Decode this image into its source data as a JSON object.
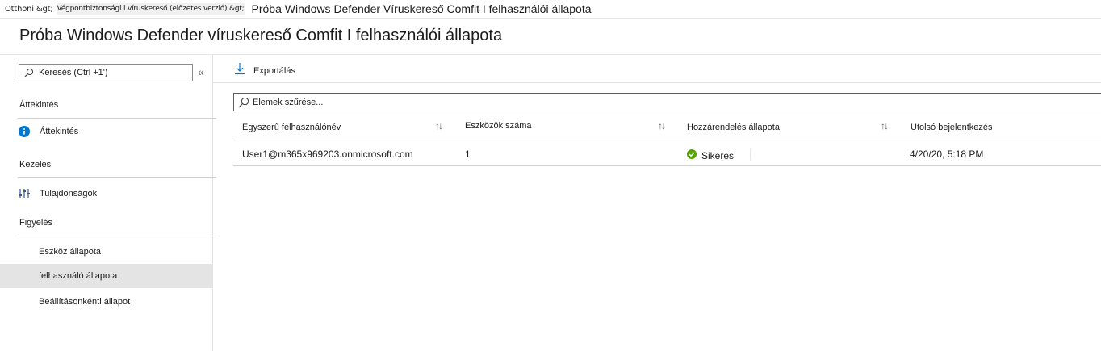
{
  "breadcrumb": {
    "home": "Otthoni &gt;",
    "parent": "Végpontbiztonsági l víruskereső (előzetes verzió) &gt;",
    "current": "Próba Windows Defender Víruskereső Comfit I felhasználói állapota"
  },
  "header": {
    "title": "Próba Windows Defender víruskereső Comfit I felhasználói állapota"
  },
  "sidebar": {
    "search_label": "Keresés (Ctrl +1')",
    "collapse_glyph": "«",
    "sections": {
      "overview": "Áttekintés",
      "manage": "Kezelés",
      "monitor": "Figyelés"
    },
    "items": {
      "overview": "Áttekintés",
      "properties": "Tulajdonságok",
      "device_status": "Eszköz állapota",
      "user_status": "felhasználó állapota",
      "per_setting_status": "Beállításonkénti állapot"
    }
  },
  "toolbar": {
    "export_label": "Exportálás"
  },
  "filter": {
    "placeholder": "Elemek szűrése..."
  },
  "table": {
    "columns": {
      "username": "Egyszerű felhasználónév",
      "device_count": "Eszközök száma",
      "assignment_status": "Hozzárendelés állapota",
      "last_signin": "Utolsó bejelentkezés"
    },
    "sort_glyph": "↑↓",
    "rows": [
      {
        "username": "User1@m365x969203.onmicrosoft.com",
        "device_count": "1",
        "assignment_status": "Sikeres",
        "last_signin": "4/20/20, 5:18 PM"
      }
    ]
  },
  "colors": {
    "accent": "#0078d4",
    "success": "#57a300",
    "info": "#0078d4",
    "selected_bg": "#e4e4e4"
  },
  "icons": {
    "search": "search-icon",
    "export": "download-icon",
    "overview": "info-icon",
    "properties": "properties-icon",
    "success": "checkmark-circle-icon"
  }
}
